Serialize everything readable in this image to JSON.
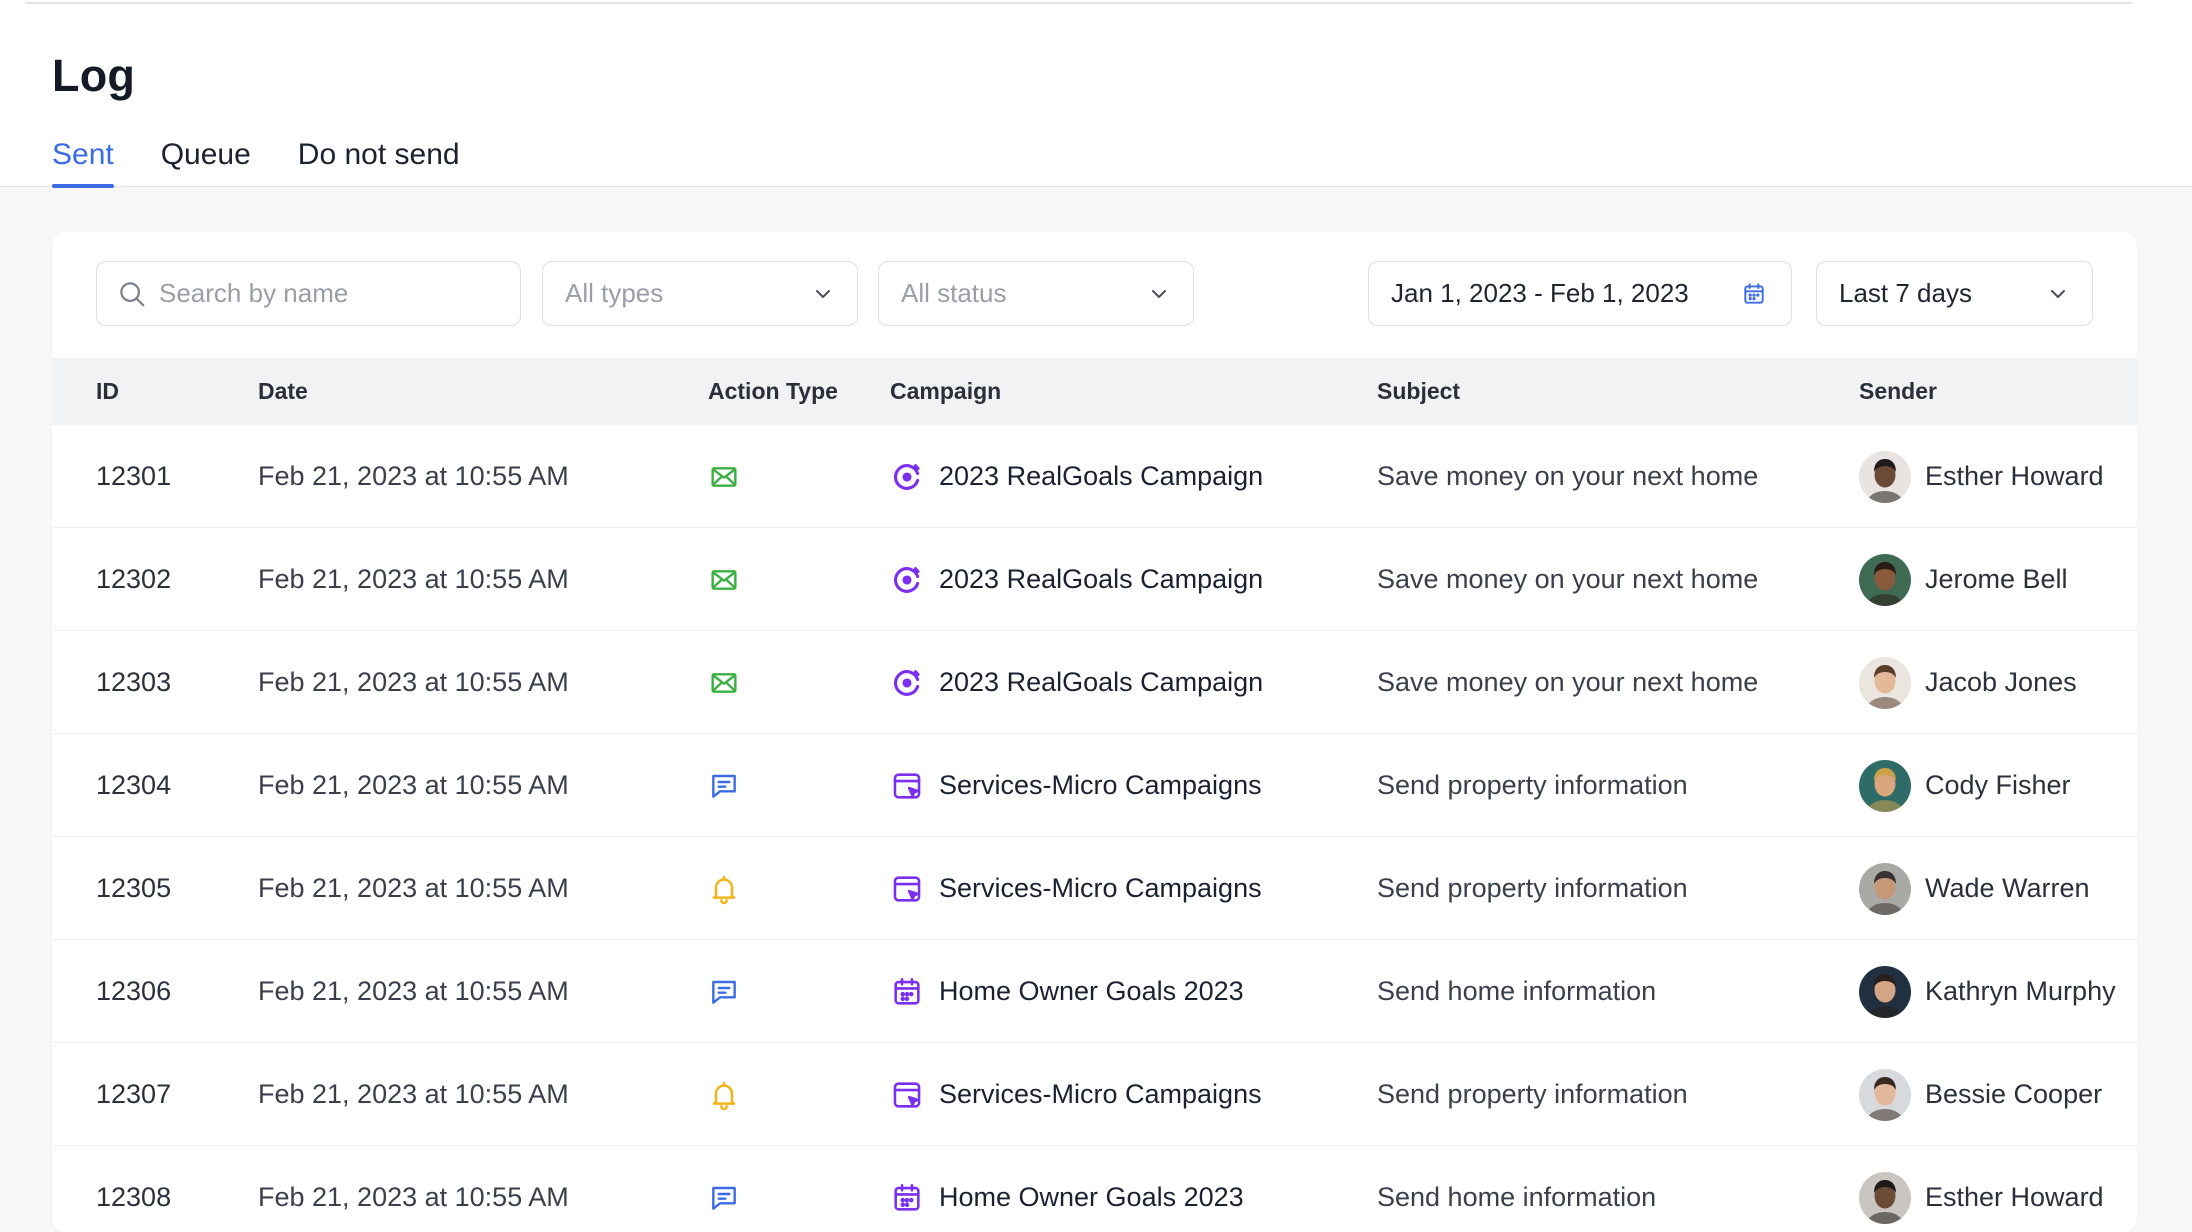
{
  "page": {
    "title": "Log"
  },
  "tabs": [
    {
      "label": "Sent",
      "active": true
    },
    {
      "label": "Queue",
      "active": false
    },
    {
      "label": "Do not send",
      "active": false
    }
  ],
  "filters": {
    "search_placeholder": "Search by name",
    "types_value": "All types",
    "status_value": "All status",
    "date_range": "Jan 1, 2023 - Feb 1, 2023",
    "period": "Last 7 days"
  },
  "columns": {
    "id": "ID",
    "date": "Date",
    "action_type": "Action Type",
    "campaign": "Campaign",
    "subject": "Subject",
    "sender": "Sender"
  },
  "colors": {
    "accent": "#3b6ce4",
    "email_icon": "#3cb043",
    "chat_icon": "#3b6ce4",
    "bell_icon": "#f2b51b",
    "campaign_icon": "#7b2ff0"
  },
  "rows": [
    {
      "id": "12301",
      "date": "Feb 21, 2023 at 10:55 AM",
      "action": "email-icon",
      "campaign_icon": "target-icon",
      "campaign": "2023 RealGoals Campaign",
      "subject": "Save money on your next home",
      "sender": "Esther Howard",
      "avatar_bg": "#e8e4e1",
      "skin": "#6b4a36",
      "hair": "#1e1a19"
    },
    {
      "id": "12302",
      "date": "Feb 21, 2023 at 10:55 AM",
      "action": "email-icon",
      "campaign_icon": "target-icon",
      "campaign": "2023 RealGoals Campaign",
      "subject": "Save money on your next home",
      "sender": "Jerome Bell",
      "avatar_bg": "#3f6b55",
      "skin": "#8a5a3c",
      "hair": "#2a1d16"
    },
    {
      "id": "12303",
      "date": "Feb 21, 2023 at 10:55 AM",
      "action": "email-icon",
      "campaign_icon": "target-icon",
      "campaign": "2023 RealGoals Campaign",
      "subject": "Save money on your next home",
      "sender": "Jacob Jones",
      "avatar_bg": "#eae6df",
      "skin": "#e3b99a",
      "hair": "#5a3d2a"
    },
    {
      "id": "12304",
      "date": "Feb 21, 2023 at 10:55 AM",
      "action": "chat-icon",
      "campaign_icon": "calendar-browser-icon",
      "campaign": "Services-Micro Campaigns",
      "subject": "Send property information",
      "sender": "Cody Fisher",
      "avatar_bg": "#2f6b67",
      "skin": "#d9a57c",
      "hair": "#caa24a"
    },
    {
      "id": "12305",
      "date": "Feb 21, 2023 at 10:55 AM",
      "action": "bell-icon",
      "campaign_icon": "calendar-browser-icon",
      "campaign": "Services-Micro Campaigns",
      "subject": "Send property information",
      "sender": "Wade Warren",
      "avatar_bg": "#a9aaa6",
      "skin": "#c7977a",
      "hair": "#3a3331"
    },
    {
      "id": "12306",
      "date": "Feb 21, 2023 at 10:55 AM",
      "action": "chat-icon",
      "campaign_icon": "calendar-icon",
      "campaign": "Home Owner Goals 2023",
      "subject": "Send home information",
      "sender": "Kathryn Murphy",
      "avatar_bg": "#203040",
      "skin": "#d6a585",
      "hair": "#2a1f1b"
    },
    {
      "id": "12307",
      "date": "Feb 21, 2023 at 10:55 AM",
      "action": "bell-icon",
      "campaign_icon": "calendar-browser-icon",
      "campaign": "Services-Micro Campaigns",
      "subject": "Send property information",
      "sender": "Bessie Cooper",
      "avatar_bg": "#d7d9dd",
      "skin": "#e3b89a",
      "hair": "#3b2a20"
    },
    {
      "id": "12308",
      "date": "Feb 21, 2023 at 10:55 AM",
      "action": "chat-icon",
      "campaign_icon": "calendar-icon",
      "campaign": "Home Owner Goals 2023",
      "subject": "Send home information",
      "sender": "Esther Howard",
      "avatar_bg": "#c9c5c0",
      "skin": "#6b4a36",
      "hair": "#1e1a19"
    }
  ]
}
